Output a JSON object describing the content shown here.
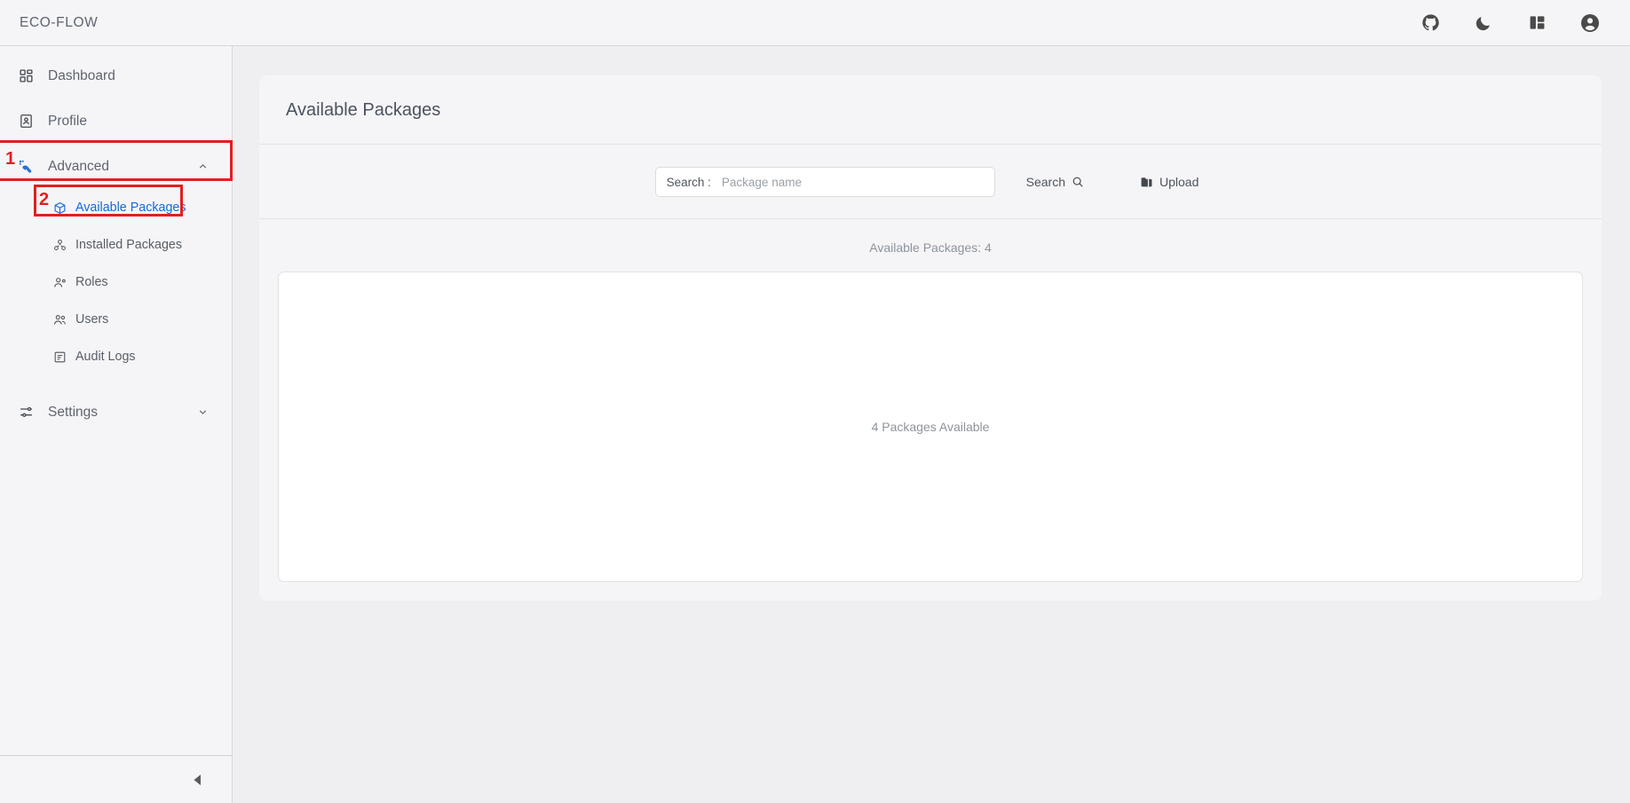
{
  "header": {
    "brand": "ECO-FLOW",
    "icons": [
      {
        "name": "github-icon",
        "label": "GitHub"
      },
      {
        "name": "moon-icon",
        "label": "Dark mode"
      },
      {
        "name": "layout-icon",
        "label": "Layout"
      },
      {
        "name": "account-circle-icon",
        "label": "Account"
      }
    ]
  },
  "sidebar": {
    "items": [
      {
        "label": "Dashboard",
        "icon": "dashboard-grid-icon",
        "expandable": false,
        "active": false
      },
      {
        "label": "Profile",
        "icon": "profile-card-icon",
        "expandable": false,
        "active": false
      },
      {
        "label": "Advanced",
        "icon": "advanced-tools-icon",
        "expandable": true,
        "expanded": true,
        "active": false
      }
    ],
    "advanced_children": [
      {
        "label": "Available Packages",
        "icon": "package-cube-icon",
        "active": true
      },
      {
        "label": "Installed Packages",
        "icon": "installed-packages-icon",
        "active": false
      },
      {
        "label": "Roles",
        "icon": "user-role-icon",
        "active": false
      },
      {
        "label": "Users",
        "icon": "users-icon",
        "active": false
      },
      {
        "label": "Audit Logs",
        "icon": "audit-log-icon",
        "active": false
      }
    ],
    "settings": {
      "label": "Settings",
      "icon": "sliders-icon",
      "expandable": true,
      "expanded": false
    },
    "collapse": {
      "name": "collapse-sidebar-button",
      "icon": "triangle-left-icon"
    }
  },
  "annotations": [
    {
      "number": "1",
      "target": "Advanced"
    },
    {
      "number": "2",
      "target": "Available Packages"
    }
  ],
  "main": {
    "page_title": "Available Packages",
    "search": {
      "label": "Search :",
      "placeholder": "Package name",
      "value": ""
    },
    "search_button": "Search",
    "upload_button": "Upload",
    "count_text": "Available Packages: 4",
    "empty_card_text": "4 Packages Available"
  },
  "colors": {
    "accent_blue": "#1668d8",
    "annotation_red": "#e31f1f",
    "sidebar_bg": "#f5f5f7",
    "page_bg": "#efeff1"
  }
}
